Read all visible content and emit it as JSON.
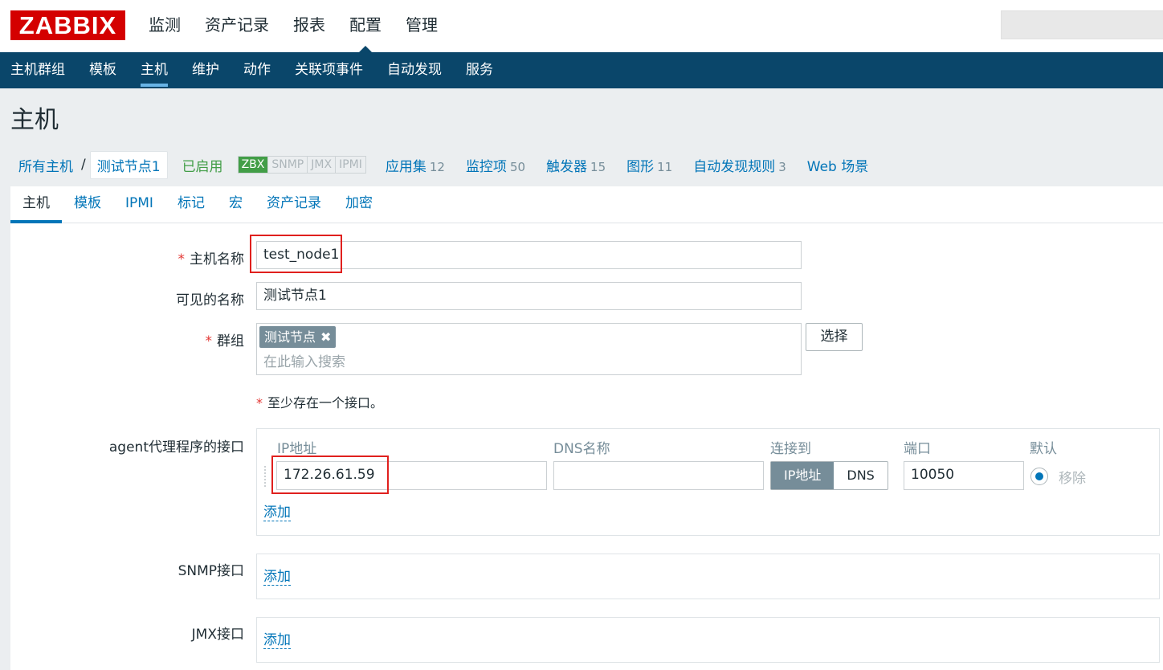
{
  "header": {
    "logo": "ZABBIX",
    "nav": [
      "监测",
      "资产记录",
      "报表",
      "配置",
      "管理"
    ],
    "active_nav": "配置"
  },
  "subnav": [
    "主机群组",
    "模板",
    "主机",
    "维护",
    "动作",
    "关联项事件",
    "自动发现",
    "服务"
  ],
  "page_title": "主机",
  "hostbar": {
    "all_hosts": "所有主机",
    "separator": "/",
    "current_host": "测试节点1",
    "status": "已启用",
    "availability": [
      "ZBX",
      "SNMP",
      "JMX",
      "IPMI"
    ],
    "items": [
      {
        "label": "应用集",
        "count": "12"
      },
      {
        "label": "监控项",
        "count": "50"
      },
      {
        "label": "触发器",
        "count": "15"
      },
      {
        "label": "图形",
        "count": "11"
      },
      {
        "label": "自动发现规则",
        "count": "3"
      },
      {
        "label": "Web 场景",
        "count": ""
      }
    ]
  },
  "tabs": [
    "主机",
    "模板",
    "IPMI",
    "标记",
    "宏",
    "资产记录",
    "加密"
  ],
  "form": {
    "host_name_label": "主机名称",
    "host_name_value": "test_node1",
    "visible_name_label": "可见的名称",
    "visible_name_value": "测试节点1",
    "groups_label": "群组",
    "group_tag": "测试节点",
    "group_remove": "✖",
    "groups_placeholder": "在此输入搜索",
    "select_button": "选择",
    "required_mark": "*",
    "interface_note": "至少存在一个接口。",
    "agent_label": "agent代理程序的接口",
    "columns": {
      "ip": "IP地址",
      "dns": "DNS名称",
      "connect": "连接到",
      "port": "端口",
      "default": "默认"
    },
    "agent_ip": "172.26.61.59",
    "agent_dns": "",
    "connect_ip": "IP地址",
    "connect_dns": "DNS",
    "agent_port": "10050",
    "remove": "移除",
    "add": "添加",
    "snmp_label": "SNMP接口",
    "jmx_label": "JMX接口"
  },
  "colors": {
    "brand": "#d40000",
    "nav_bg": "#0a466a",
    "link": "#0275b8",
    "enabled": "#429e47",
    "highlight": "#e0201e"
  }
}
